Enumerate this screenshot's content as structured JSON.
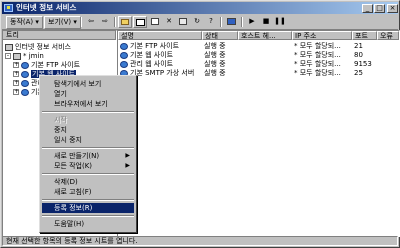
{
  "window": {
    "title": "인터넷 정보 서비스",
    "minimize": "_",
    "maximize": "□",
    "close": "×"
  },
  "toolbar": {
    "menus": [
      "동작(A) ▾",
      "보기(V) ▾"
    ],
    "buttons": [
      "back-icon",
      "forward-icon",
      "up-folder-icon",
      "show-tree-icon",
      "export-list-icon",
      "delete-icon",
      "properties-icon",
      "refresh-icon",
      "computer-icon",
      "play-icon",
      "stop-icon",
      "pause-icon"
    ]
  },
  "tree": {
    "header": "트리",
    "items": [
      {
        "label": "인터넷 정보 서비스",
        "level": 0,
        "expander": "",
        "icon": "computer"
      },
      {
        "label": "* jmin",
        "level": 1,
        "expander": "-",
        "icon": "computer"
      },
      {
        "label": "기본 FTP 사이트",
        "level": 2,
        "expander": "+",
        "icon": "globe"
      },
      {
        "label": "기본 웹 사이트",
        "level": 2,
        "expander": "+",
        "icon": "globe",
        "selected": true
      },
      {
        "label": "관리 웹",
        "level": 2,
        "expander": "+",
        "icon": "globe"
      },
      {
        "label": "기본 S",
        "level": 2,
        "expander": "+",
        "icon": "globe"
      }
    ]
  },
  "list": {
    "columns": [
      "설명",
      "상태",
      "호스트 헤...",
      "IP 주소",
      "포트",
      "오류"
    ],
    "rows": [
      {
        "name": "기본 FTP 사이트",
        "status": "실행 중",
        "host": "",
        "ip": "* 모두 할당되...",
        "port": "21",
        "error": ""
      },
      {
        "name": "기본 웹 사이트",
        "status": "실행 중",
        "host": "",
        "ip": "* 모두 할당되...",
        "port": "80",
        "error": ""
      },
      {
        "name": "관리 웹 사이트",
        "status": "실행 중",
        "host": "",
        "ip": "* 모두 할당되...",
        "port": "9153",
        "error": ""
      },
      {
        "name": "기본 SMTP 가상 서버",
        "status": "실행 중",
        "host": "",
        "ip": "* 모두 할당되...",
        "port": "25",
        "error": ""
      }
    ]
  },
  "context_menu": {
    "items": [
      {
        "label": "탐색기에서 보기"
      },
      {
        "label": "열기"
      },
      {
        "label": "브라우저에서 보기"
      },
      {
        "separator": true
      },
      {
        "label": "시작",
        "disabled": true
      },
      {
        "label": "중지"
      },
      {
        "label": "일시 중지"
      },
      {
        "separator": true
      },
      {
        "label": "새로 만들기(N)",
        "submenu": true
      },
      {
        "label": "모든 작업(K)",
        "submenu": true
      },
      {
        "separator": true
      },
      {
        "label": "삭제(D)"
      },
      {
        "label": "새로 고침(F)"
      },
      {
        "separator": true
      },
      {
        "label": "등록 정보(R)",
        "selected": true
      },
      {
        "separator": true
      },
      {
        "label": "도움말(H)"
      }
    ]
  },
  "status_bar": {
    "text": "현재 선택한 항목의 등록 정보 시트를 엽니다."
  },
  "colors": {
    "title_start": "#0a246a",
    "title_end": "#a6caf0",
    "selection": "#0a246a",
    "face": "#c0c0c0"
  }
}
